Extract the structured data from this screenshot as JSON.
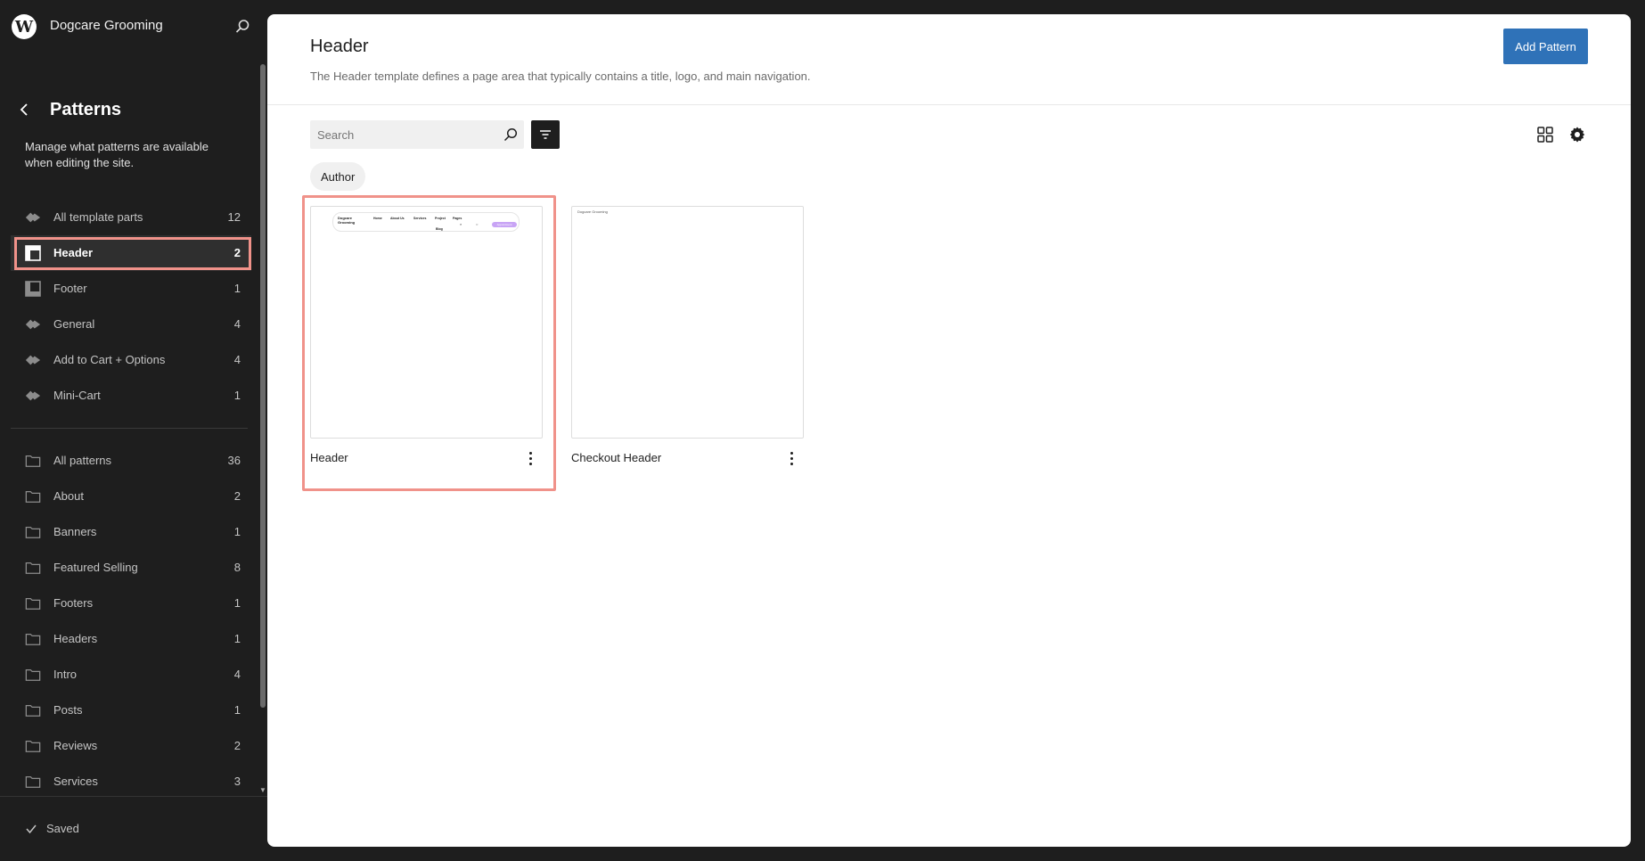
{
  "site": {
    "title": "Dogcare Grooming"
  },
  "sidebar": {
    "title": "Patterns",
    "description": "Manage what patterns are available when editing the site.",
    "template_parts": [
      {
        "label": "All template parts",
        "count": "12",
        "icon": "diamond-icon"
      },
      {
        "label": "Header",
        "count": "2",
        "icon": "header-layout-icon"
      },
      {
        "label": "Footer",
        "count": "1",
        "icon": "footer-layout-icon"
      },
      {
        "label": "General",
        "count": "4",
        "icon": "diamond-icon"
      },
      {
        "label": "Add to Cart + Options",
        "count": "4",
        "icon": "diamond-icon"
      },
      {
        "label": "Mini-Cart",
        "count": "1",
        "icon": "diamond-icon"
      }
    ],
    "patterns": [
      {
        "label": "All patterns",
        "count": "36",
        "icon": "folder-icon"
      },
      {
        "label": "About",
        "count": "2",
        "icon": "folder-icon"
      },
      {
        "label": "Banners",
        "count": "1",
        "icon": "folder-icon"
      },
      {
        "label": "Featured Selling",
        "count": "8",
        "icon": "folder-icon"
      },
      {
        "label": "Footers",
        "count": "1",
        "icon": "folder-icon"
      },
      {
        "label": "Headers",
        "count": "1",
        "icon": "folder-icon"
      },
      {
        "label": "Intro",
        "count": "4",
        "icon": "folder-icon"
      },
      {
        "label": "Posts",
        "count": "1",
        "icon": "folder-icon"
      },
      {
        "label": "Reviews",
        "count": "2",
        "icon": "folder-icon"
      },
      {
        "label": "Services",
        "count": "3",
        "icon": "folder-icon"
      }
    ],
    "active_item": "Header",
    "save_status": "Saved"
  },
  "main": {
    "title": "Header",
    "description": "The Header template defines a page area that typically contains a title, logo, and main navigation.",
    "add_button": "Add Pattern",
    "search": {
      "placeholder": "Search",
      "value": ""
    },
    "filter_chip": "Author",
    "cards": [
      {
        "title": "Header",
        "preview": {
          "logo": "Dogcare Grooming",
          "nav": [
            "Home",
            "About Us",
            "Services",
            "Project",
            "Pages",
            "Blog"
          ],
          "button": "Appointment"
        }
      },
      {
        "title": "Checkout Header",
        "preview": {
          "text": "Dogcare Grooming"
        }
      }
    ]
  },
  "colors": {
    "sidebar_bg": "#1e1e1e",
    "canvas_bg": "#ffffff",
    "primary_button": "#2f72b8",
    "highlight": "#f0928a",
    "preview_button": "#c8a4f5"
  }
}
